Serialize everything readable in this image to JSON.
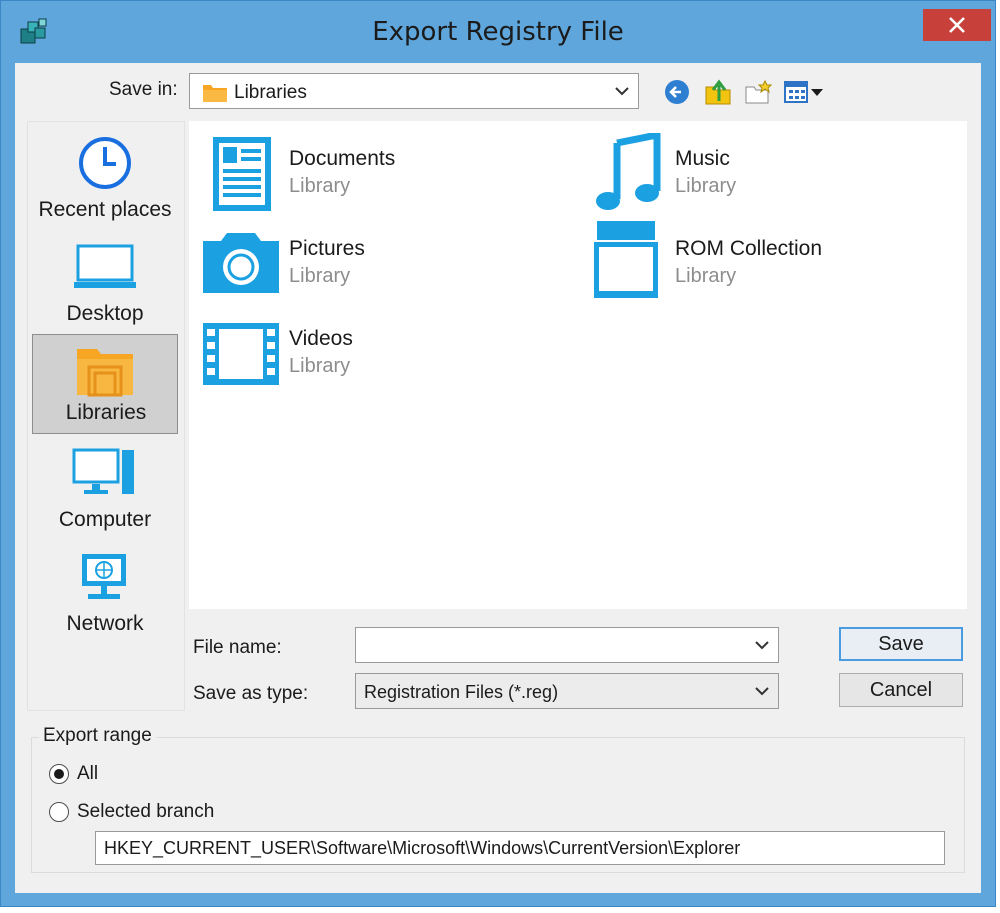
{
  "window": {
    "title": "Export Registry File"
  },
  "toolbar": {
    "save_in_label": "Save in:",
    "save_in_value": "Libraries",
    "icons": [
      "back-arrow-icon",
      "up-folder-icon",
      "new-folder-icon",
      "view-menu-icon"
    ]
  },
  "places": [
    {
      "label": "Recent places",
      "icon": "clock-icon"
    },
    {
      "label": "Desktop",
      "icon": "desktop-icon"
    },
    {
      "label": "Libraries",
      "icon": "libraries-icon",
      "selected": true
    },
    {
      "label": "Computer",
      "icon": "computer-icon"
    },
    {
      "label": "Network",
      "icon": "network-icon"
    }
  ],
  "libraries": [
    {
      "name": "Documents",
      "type": "Library",
      "icon": "documents-icon"
    },
    {
      "name": "Music",
      "type": "Library",
      "icon": "music-icon"
    },
    {
      "name": "Pictures",
      "type": "Library",
      "icon": "pictures-icon"
    },
    {
      "name": "ROM Collection",
      "type": "Library",
      "icon": "library-icon"
    },
    {
      "name": "Videos",
      "type": "Library",
      "icon": "videos-icon"
    }
  ],
  "form": {
    "file_name_label": "File name:",
    "file_name_value": "",
    "save_type_label": "Save as type:",
    "save_type_value": "Registration Files (*.reg)"
  },
  "buttons": {
    "save": "Save",
    "cancel": "Cancel"
  },
  "export_range": {
    "title": "Export range",
    "all_label": "All",
    "selected_branch_label": "Selected branch",
    "branch_value": "HKEY_CURRENT_USER\\Software\\Microsoft\\Windows\\CurrentVersion\\Explorer",
    "selected_option": "All"
  },
  "colors": {
    "titlebar": "#5ea6db",
    "accent_icon": "#1ba1e2",
    "folder": "#f6a623",
    "close": "#c7403a"
  }
}
